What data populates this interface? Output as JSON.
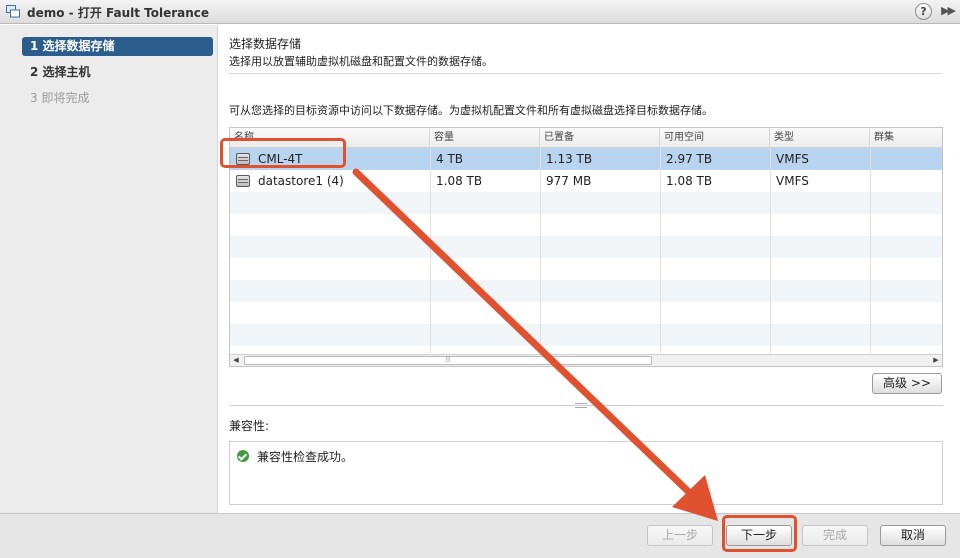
{
  "window": {
    "title": "demo - 打开 Fault Tolerance",
    "help_label": "?",
    "expand_label": "▶▶"
  },
  "sidebar": {
    "steps": [
      {
        "label": "1  选择数据存储"
      },
      {
        "label": "2  选择主机"
      },
      {
        "label": "3  即将完成"
      }
    ]
  },
  "main": {
    "section_title": "选择数据存储",
    "section_desc": "选择用以放置辅助虚拟机磁盘和配置文件的数据存储。",
    "instruction": "可从您选择的目标资源中访问以下数据存储。为虚拟机配置文件和所有虚拟磁盘选择目标数据存储。",
    "table": {
      "columns": [
        "名称",
        "容量",
        "已置备",
        "可用空间",
        "类型",
        "群集"
      ],
      "rows": [
        {
          "name": "CML-4T",
          "capacity": "4 TB",
          "provisioned": "1.13 TB",
          "free": "2.97 TB",
          "type": "VMFS",
          "cluster": ""
        },
        {
          "name": "datastore1 (4)",
          "capacity": "1.08 TB",
          "provisioned": "977 MB",
          "free": "1.08 TB",
          "type": "VMFS",
          "cluster": ""
        }
      ],
      "scroll_left_label": "◀",
      "scroll_right_label": "▶",
      "scroll_thumb_label": "⁞⁞"
    },
    "advanced_label": "高级 >>",
    "compat": {
      "label": "兼容性:",
      "message": "兼容性检查成功。"
    }
  },
  "footer": {
    "back_label": "上一步",
    "next_label": "下一步",
    "finish_label": "完成",
    "cancel_label": "取消"
  },
  "colors": {
    "accent": "#2b5d8d",
    "selected_row": "#b8d4ee",
    "annotation": "#e0522f",
    "success": "#3e9c3a"
  }
}
